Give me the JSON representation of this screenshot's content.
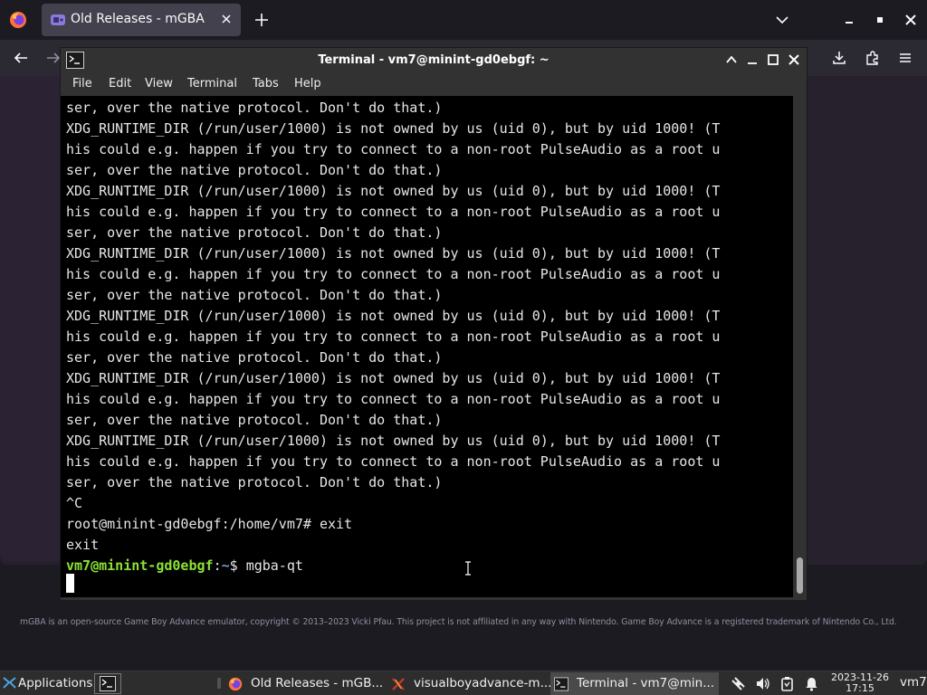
{
  "browser": {
    "tab_title": "Old Releases - mGBA",
    "icons": {
      "app_menu": "firefox-icon",
      "tab_favicon": "mgba-favicon",
      "tab_close": "close-icon",
      "new_tab": "plus-icon",
      "list_all_tabs": "chevron-down-icon",
      "back": "arrow-left-icon",
      "forward": "arrow-right-icon",
      "downloads": "download-icon",
      "extensions": "puzzle-icon",
      "menu": "hamburger-icon"
    },
    "footer_text": "mGBA is an open-source Game Boy Advance emulator, copyright © 2013–2023 Vicki Pfau. This project is not affiliated in any way with Nintendo. Game Boy Advance is a registered trademark of Nintendo Co., Ltd."
  },
  "terminal": {
    "title": "Terminal - vm7@minint-gd0ebgf: ~",
    "menu": [
      "File",
      "Edit",
      "View",
      "Terminal",
      "Tabs",
      "Help"
    ],
    "lines": [
      "ser, over the native protocol. Don't do that.)",
      "XDG_RUNTIME_DIR (/run/user/1000) is not owned by us (uid 0), but by uid 1000! (T",
      "his could e.g. happen if you try to connect to a non-root PulseAudio as a root u",
      "ser, over the native protocol. Don't do that.)",
      "XDG_RUNTIME_DIR (/run/user/1000) is not owned by us (uid 0), but by uid 1000! (T",
      "his could e.g. happen if you try to connect to a non-root PulseAudio as a root u",
      "ser, over the native protocol. Don't do that.)",
      "XDG_RUNTIME_DIR (/run/user/1000) is not owned by us (uid 0), but by uid 1000! (T",
      "his could e.g. happen if you try to connect to a non-root PulseAudio as a root u",
      "ser, over the native protocol. Don't do that.)",
      "XDG_RUNTIME_DIR (/run/user/1000) is not owned by us (uid 0), but by uid 1000! (T",
      "his could e.g. happen if you try to connect to a non-root PulseAudio as a root u",
      "ser, over the native protocol. Don't do that.)",
      "XDG_RUNTIME_DIR (/run/user/1000) is not owned by us (uid 0), but by uid 1000! (T",
      "his could e.g. happen if you try to connect to a non-root PulseAudio as a root u",
      "ser, over the native protocol. Don't do that.)",
      "XDG_RUNTIME_DIR (/run/user/1000) is not owned by us (uid 0), but by uid 1000! (T",
      "his could e.g. happen if you try to connect to a non-root PulseAudio as a root u",
      "ser, over the native protocol. Don't do that.)",
      "^C",
      "root@minint-gd0ebgf:/home/vm7# exit",
      "exit"
    ],
    "prompt": {
      "user_host": "vm7@minint-gd0ebgf",
      "separator": ":",
      "path": "~",
      "symbol": "$ ",
      "command": "mgba-qt"
    },
    "colors": {
      "background": "#000000",
      "text": "#e6e6e6",
      "prompt_user": "#8ae234",
      "prompt_path": "#729fcf"
    },
    "icons": {
      "app": "terminal-icon",
      "maximize_other": "chevron-up-icon",
      "minimize": "minimize-icon",
      "maximize": "maximize-icon",
      "close": "close-icon"
    }
  },
  "taskbar": {
    "applications_label": "Applications",
    "tasks": [
      {
        "label": "Old Releases - mGB...",
        "icon": "firefox-icon"
      },
      {
        "label": "visualboyadvance-m...",
        "icon": "vba-icon"
      },
      {
        "label": "Terminal - vm7@min...",
        "icon": "terminal-icon"
      }
    ],
    "tray_icons": [
      "network-icon",
      "volume-icon",
      "clipboard-icon",
      "notification-bell-icon"
    ],
    "clock_date": "2023-11-26",
    "clock_time": "17:15",
    "user": "vm7"
  }
}
